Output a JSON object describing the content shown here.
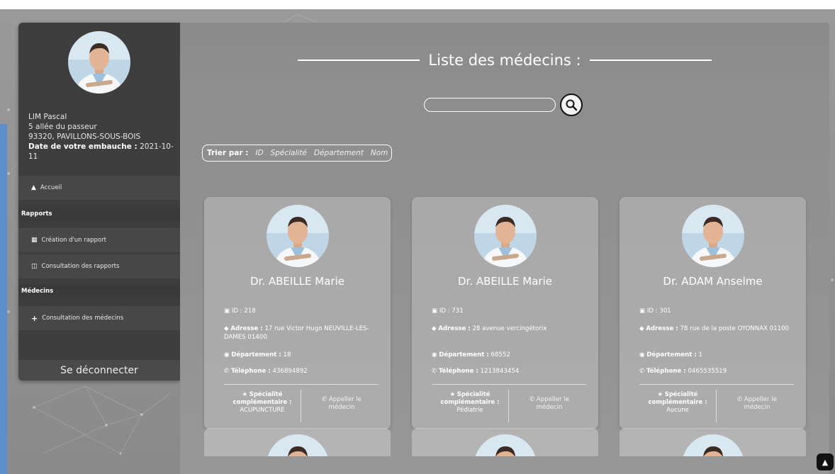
{
  "colors": {
    "sidebar": "#3e3e3e",
    "accent_stripe": "#5b8fc9",
    "card_text": "#ffffff"
  },
  "user": {
    "name": "LIM Pascal",
    "address_line1": "5 allée du passeur",
    "address_line2": "93320, PAVILLONS-SOUS-BOIS",
    "hire_label": "Date de votre embauche :",
    "hire_date": "2021-10-11"
  },
  "sidebar": {
    "home": "Accueil",
    "reports_section": "Rapports",
    "create_report": "Création d'un rapport",
    "view_reports": "Consultation des rapports",
    "doctors_section": "Médecins",
    "view_doctors": "Consultation des médecins",
    "logout": "Se déconnecter"
  },
  "main": {
    "title": "Liste des médecins :",
    "search": {
      "value": "",
      "placeholder": ""
    },
    "sort": {
      "label": "Trier par :",
      "options": [
        "ID",
        "Spécialité",
        "Département",
        "Nom"
      ]
    }
  },
  "labels": {
    "id": "ID :",
    "address": "Adresse :",
    "department": "Département :",
    "phone": "Téléphone :",
    "specialty_line1": "Spécialité",
    "specialty_line2": "complémentaire :",
    "call_line1": "Appeller le",
    "call_line2": "médecin"
  },
  "doctors": [
    {
      "name": "Dr. ABEILLE Marie",
      "id": "218",
      "address": "17 rue Victor Hugo NEUVILLE-LES-DAMES 01400",
      "department": "18",
      "phone": "436894892",
      "specialty": "ACUPUNCTURE"
    },
    {
      "name": "Dr. ABEILLE Marie",
      "id": "731",
      "address": "28 avenue vercingétorix",
      "department": "68552",
      "phone": "1213843454",
      "specialty": "Pédiatrie"
    },
    {
      "name": "Dr. ADAM Anselme",
      "id": "301",
      "address": "78 rue de la poste OYONNAX 01100",
      "department": "1",
      "phone": "0465535519",
      "specialty": "Aucune"
    }
  ]
}
